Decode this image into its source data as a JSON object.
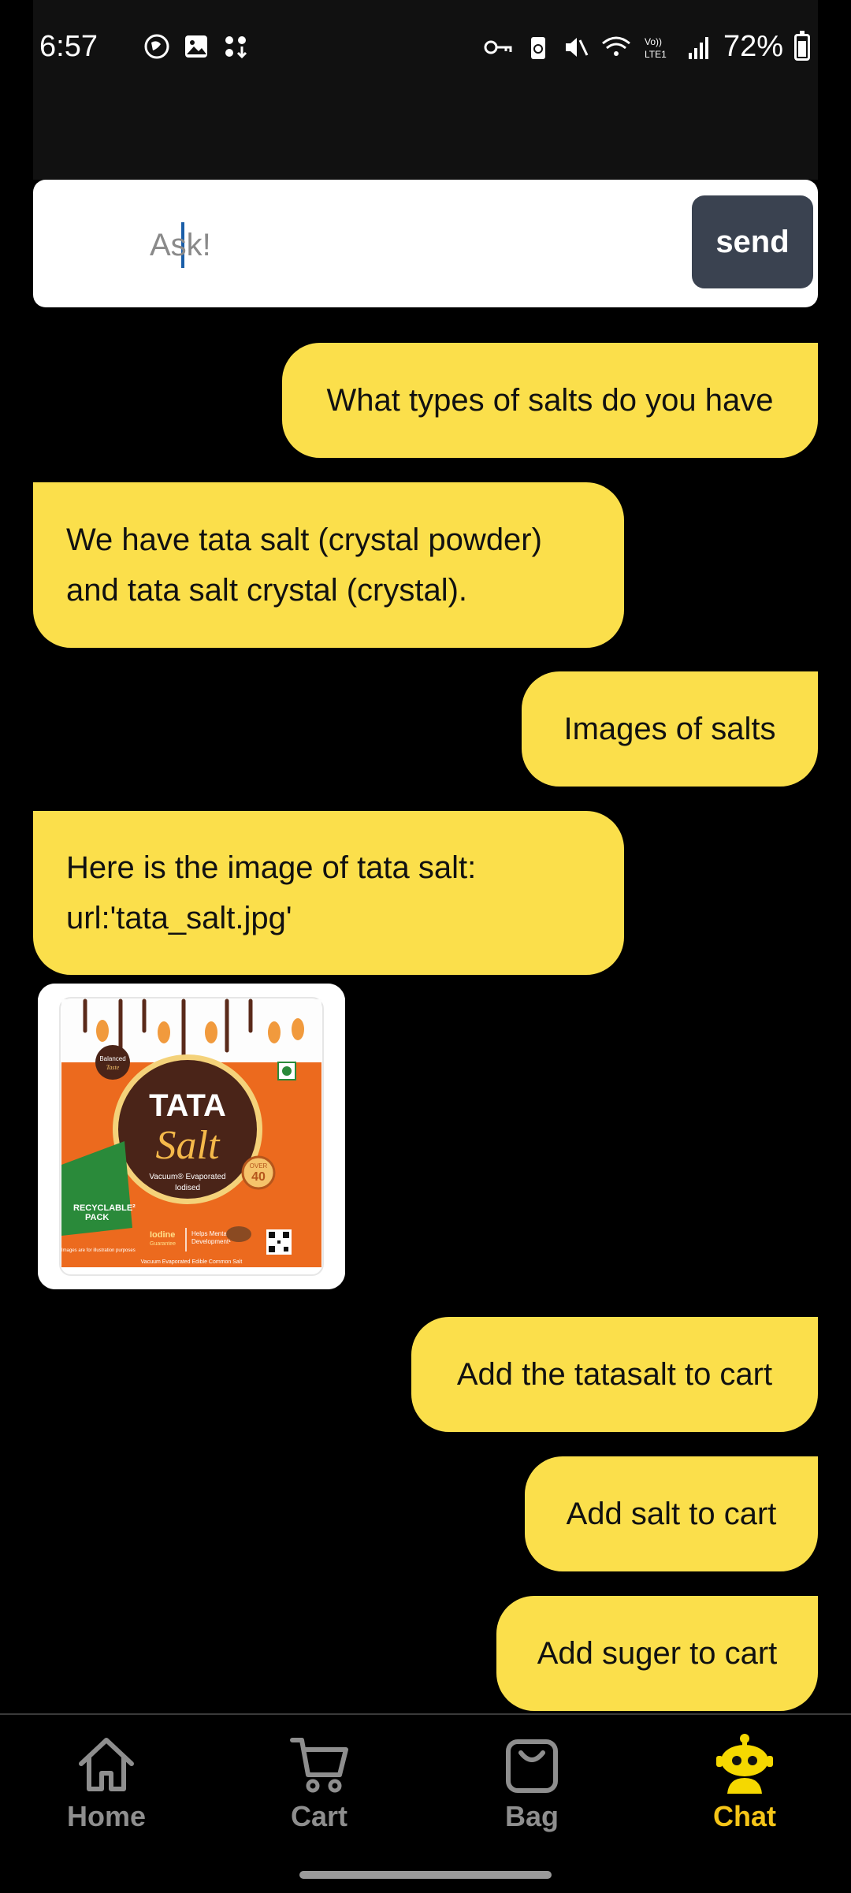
{
  "status": {
    "time": "6:57",
    "battery": "72%"
  },
  "ask": {
    "placeholder": "Ask!",
    "send_label": "send"
  },
  "messages": [
    {
      "role": "user",
      "text": "What types of salts do you have"
    },
    {
      "role": "bot",
      "text": "We have tata salt (crystal powder)\nand tata salt crystal (crystal)."
    },
    {
      "role": "user",
      "text": "Images of salts"
    },
    {
      "role": "bot",
      "text": "Here is the image of tata salt:\nurl:'tata_salt.jpg'"
    },
    {
      "role": "user",
      "text": "Add the tatasalt to cart"
    },
    {
      "role": "user",
      "text": "Add salt to cart"
    },
    {
      "role": "user",
      "text": "Add suger to cart"
    }
  ],
  "product_image": {
    "brand": "TATA",
    "product": "Salt",
    "desc_line1": "Vacuum® Evaporated",
    "desc_line2": "Iodised",
    "badge_top": "Balanced",
    "badge_bottom": "Taste",
    "recycle_line1": "RECYCLABLE²",
    "recycle_line2": "PACK",
    "over_top": "OVER",
    "over_num": "40",
    "iodine": "Iodine",
    "iodine_sub": "Guarantee",
    "mental": "Helps Mental",
    "mental_sub": "Development¹",
    "bottom_text": "Vacuum Evaporated Edible Common Salt",
    "tiny_text": "Images are for illustration purposes"
  },
  "nav": [
    {
      "label": "Home",
      "icon": "home-icon",
      "active": false
    },
    {
      "label": "Cart",
      "icon": "cart-icon",
      "active": false
    },
    {
      "label": "Bag",
      "icon": "bag-icon",
      "active": false
    },
    {
      "label": "Chat",
      "icon": "robot-icon",
      "active": true
    }
  ],
  "colors": {
    "bubble": "#fbdf4b",
    "active_nav": "#f5c518",
    "inactive_nav": "#8e8e8e",
    "send_button": "#3a4250"
  }
}
